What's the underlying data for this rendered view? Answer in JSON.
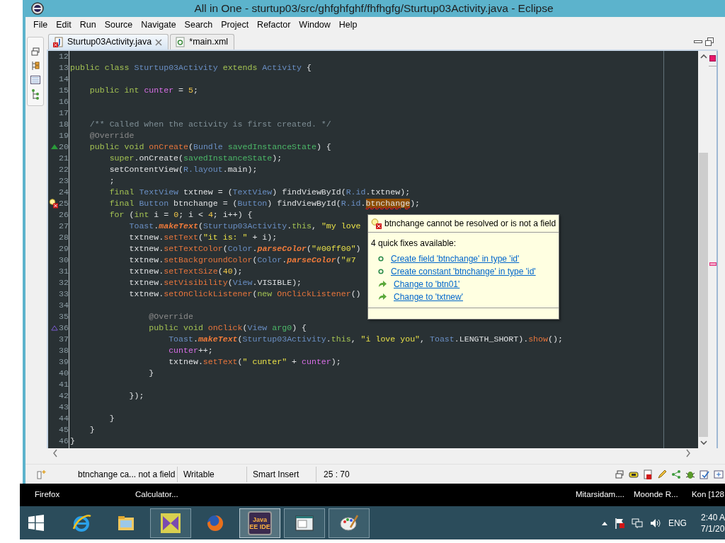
{
  "window": {
    "title": "All in One - sturtup03/src/ghfghfghf/fhfhgfg/Sturtup03Activity.java - Eclipse"
  },
  "menu": [
    "File",
    "Edit",
    "Run",
    "Source",
    "Navigate",
    "Search",
    "Project",
    "Refactor",
    "Window",
    "Help"
  ],
  "editor_tabs": [
    {
      "label": "Sturtup03Activity.java",
      "kind": "java",
      "error": true,
      "selected": true
    },
    {
      "label": "*main.xml",
      "kind": "xml",
      "error": false,
      "selected": false
    }
  ],
  "code_lines": [
    {
      "number": "12"
    },
    {
      "number": "13",
      "tokens": [
        {
          "kind": "kw",
          "text": "public class "
        },
        {
          "kind": "type",
          "text": "Sturtup03Activity "
        },
        {
          "kind": "kw",
          "text": "extends "
        },
        {
          "kind": "type",
          "text": "Activity "
        },
        {
          "kind": "plain",
          "text": "{"
        }
      ]
    },
    {
      "number": "14"
    },
    {
      "number": "15",
      "tokens": [
        {
          "kind": "kw",
          "text": "    public int "
        },
        {
          "kind": "field",
          "text": "cunter"
        },
        {
          "kind": "plain",
          "text": " = "
        },
        {
          "kind": "num",
          "text": "5"
        },
        {
          "kind": "plain",
          "text": ";"
        }
      ]
    },
    {
      "number": "16"
    },
    {
      "number": "17"
    },
    {
      "number": "18",
      "tokens": [
        {
          "kind": "comment",
          "text": "    /** Called when the activity is first created. */"
        }
      ]
    },
    {
      "number": "19",
      "tokens": [
        {
          "kind": "annot",
          "text": "    @Override"
        }
      ]
    },
    {
      "number": "20",
      "kind": "override",
      "tokens": [
        {
          "kind": "kw",
          "text": "    public void "
        },
        {
          "kind": "decl",
          "text": "onCreate"
        },
        {
          "kind": "plain",
          "text": "("
        },
        {
          "kind": "type",
          "text": "Bundle "
        },
        {
          "kind": "param",
          "text": "savedInstanceState"
        },
        {
          "kind": "plain",
          "text": ") {"
        }
      ]
    },
    {
      "number": "21",
      "tokens": [
        {
          "kind": "kw",
          "text": "        super"
        },
        {
          "kind": "plain",
          "text": ".onCreate("
        },
        {
          "kind": "param",
          "text": "savedInstanceState"
        },
        {
          "kind": "plain",
          "text": ");"
        }
      ]
    },
    {
      "number": "22",
      "tokens": [
        {
          "kind": "plain",
          "text": "        setContentView("
        },
        {
          "kind": "type",
          "text": "R.layout"
        },
        {
          "kind": "plain",
          "text": ".main);"
        }
      ]
    },
    {
      "number": "23",
      "tokens": [
        {
          "kind": "plain",
          "text": "        ;"
        }
      ]
    },
    {
      "number": "24",
      "tokens": [
        {
          "kind": "kw",
          "text": "        final "
        },
        {
          "kind": "type",
          "text": "TextView "
        },
        {
          "kind": "plain",
          "text": "txtnew = ("
        },
        {
          "kind": "type",
          "text": "TextView"
        },
        {
          "kind": "plain",
          "text": ") findViewById("
        },
        {
          "kind": "type",
          "text": "R.id"
        },
        {
          "kind": "plain",
          "text": ".txtnew);"
        }
      ]
    },
    {
      "number": "25",
      "kind": "error",
      "tokens": [
        {
          "kind": "kw",
          "text": "        final "
        },
        {
          "kind": "type",
          "text": "Button "
        },
        {
          "kind": "plain",
          "text": "btnchange = ("
        },
        {
          "kind": "type",
          "text": "Button"
        },
        {
          "kind": "plain",
          "text": ") findViewById("
        },
        {
          "kind": "type",
          "text": "R.id"
        },
        {
          "kind": "plain",
          "text": "."
        },
        {
          "kind": "error",
          "text": "btnchange"
        },
        {
          "kind": "plain",
          "text": ");"
        }
      ]
    },
    {
      "number": "26",
      "tokens": [
        {
          "kind": "kw",
          "text": "        for "
        },
        {
          "kind": "plain",
          "text": "("
        },
        {
          "kind": "kw",
          "text": "int "
        },
        {
          "kind": "plain",
          "text": "i = "
        },
        {
          "kind": "num",
          "text": "0"
        },
        {
          "kind": "plain",
          "text": "; i < "
        },
        {
          "kind": "num",
          "text": "4"
        },
        {
          "kind": "plain",
          "text": "; i++) {"
        }
      ]
    },
    {
      "number": "27",
      "tokens": [
        {
          "kind": "type",
          "text": "            Toast"
        },
        {
          "kind": "plain",
          "text": "."
        },
        {
          "kind": "static",
          "text": "makeText"
        },
        {
          "kind": "plain",
          "text": "("
        },
        {
          "kind": "type",
          "text": "Sturtup03Activity"
        },
        {
          "kind": "plain",
          "text": "."
        },
        {
          "kind": "kw",
          "text": "this"
        },
        {
          "kind": "plain",
          "text": ", "
        },
        {
          "kind": "str",
          "text": "\"my love"
        }
      ]
    },
    {
      "number": "28",
      "tokens": [
        {
          "kind": "plain",
          "text": "            txtnew."
        },
        {
          "kind": "call",
          "text": "setText"
        },
        {
          "kind": "plain",
          "text": "("
        },
        {
          "kind": "str",
          "text": "\"it is: \""
        },
        {
          "kind": "plain",
          "text": " + i);"
        }
      ]
    },
    {
      "number": "29",
      "tokens": [
        {
          "kind": "plain",
          "text": "            txtnew."
        },
        {
          "kind": "call",
          "text": "setTextColor"
        },
        {
          "kind": "plain",
          "text": "("
        },
        {
          "kind": "type",
          "text": "Color"
        },
        {
          "kind": "plain",
          "text": "."
        },
        {
          "kind": "static",
          "text": "parseColor"
        },
        {
          "kind": "plain",
          "text": "("
        },
        {
          "kind": "str",
          "text": "\"#00ff00\""
        },
        {
          "kind": "plain",
          "text": ")"
        }
      ]
    },
    {
      "number": "30",
      "tokens": [
        {
          "kind": "plain",
          "text": "            txtnew."
        },
        {
          "kind": "call",
          "text": "setBackgroundColor"
        },
        {
          "kind": "plain",
          "text": "("
        },
        {
          "kind": "type",
          "text": "Color"
        },
        {
          "kind": "plain",
          "text": "."
        },
        {
          "kind": "static",
          "text": "parseColor"
        },
        {
          "kind": "plain",
          "text": "("
        },
        {
          "kind": "str",
          "text": "\"#7"
        }
      ]
    },
    {
      "number": "31",
      "tokens": [
        {
          "kind": "plain",
          "text": "            txtnew."
        },
        {
          "kind": "call",
          "text": "setTextSize"
        },
        {
          "kind": "plain",
          "text": "("
        },
        {
          "kind": "num",
          "text": "40"
        },
        {
          "kind": "plain",
          "text": ");"
        }
      ]
    },
    {
      "number": "32",
      "tokens": [
        {
          "kind": "plain",
          "text": "            txtnew."
        },
        {
          "kind": "call",
          "text": "setVisibility"
        },
        {
          "kind": "plain",
          "text": "("
        },
        {
          "kind": "type",
          "text": "View"
        },
        {
          "kind": "plain",
          "text": ".VISIBLE);"
        }
      ]
    },
    {
      "number": "33",
      "tokens": [
        {
          "kind": "plain",
          "text": "            txtnew."
        },
        {
          "kind": "call",
          "text": "setOnClickListener"
        },
        {
          "kind": "plain",
          "text": "("
        },
        {
          "kind": "kw",
          "text": "new "
        },
        {
          "kind": "call",
          "text": "OnClickListener"
        },
        {
          "kind": "plain",
          "text": "()"
        }
      ]
    },
    {
      "number": "34"
    },
    {
      "number": "35",
      "tokens": [
        {
          "kind": "annot",
          "text": "                @Override"
        }
      ]
    },
    {
      "number": "36",
      "kind": "implements",
      "tokens": [
        {
          "kind": "kw",
          "text": "                public void "
        },
        {
          "kind": "decl",
          "text": "onClick"
        },
        {
          "kind": "plain",
          "text": "("
        },
        {
          "kind": "type",
          "text": "View "
        },
        {
          "kind": "param",
          "text": "arg0"
        },
        {
          "kind": "plain",
          "text": ") {"
        }
      ]
    },
    {
      "number": "37",
      "tokens": [
        {
          "kind": "type",
          "text": "                    Toast"
        },
        {
          "kind": "plain",
          "text": "."
        },
        {
          "kind": "static",
          "text": "makeText"
        },
        {
          "kind": "plain",
          "text": "("
        },
        {
          "kind": "type",
          "text": "Sturtup03Activity"
        },
        {
          "kind": "plain",
          "text": "."
        },
        {
          "kind": "kw",
          "text": "this"
        },
        {
          "kind": "plain",
          "text": ", "
        },
        {
          "kind": "str",
          "text": "\"i love you\""
        },
        {
          "kind": "plain",
          "text": ", "
        },
        {
          "kind": "type",
          "text": "Toast"
        },
        {
          "kind": "plain",
          "text": ".LENGTH_SHORT)."
        },
        {
          "kind": "call",
          "text": "show"
        },
        {
          "kind": "plain",
          "text": "();"
        }
      ]
    },
    {
      "number": "38",
      "tokens": [
        {
          "kind": "field",
          "text": "                    cunter"
        },
        {
          "kind": "plain",
          "text": "++;"
        }
      ]
    },
    {
      "number": "39",
      "tokens": [
        {
          "kind": "plain",
          "text": "                    txtnew."
        },
        {
          "kind": "call",
          "text": "setText"
        },
        {
          "kind": "plain",
          "text": "("
        },
        {
          "kind": "str",
          "text": "\" cunter\""
        },
        {
          "kind": "plain",
          "text": " + "
        },
        {
          "kind": "field",
          "text": "cunter"
        },
        {
          "kind": "plain",
          "text": ");"
        }
      ]
    },
    {
      "number": "40",
      "tokens": [
        {
          "kind": "plain",
          "text": "                }"
        }
      ]
    },
    {
      "number": "41"
    },
    {
      "number": "42",
      "tokens": [
        {
          "kind": "plain",
          "text": "            });"
        }
      ]
    },
    {
      "number": "43"
    },
    {
      "number": "44",
      "tokens": [
        {
          "kind": "plain",
          "text": "        }"
        }
      ]
    },
    {
      "number": "45",
      "tokens": [
        {
          "kind": "plain",
          "text": "    }"
        }
      ]
    },
    {
      "number": "46",
      "tokens": [
        {
          "kind": "plain",
          "text": "}"
        }
      ]
    }
  ],
  "quick_fix": {
    "message": "btnchange cannot be resolved or is not a field",
    "summary": "4 quick fixes available:",
    "fixes": [
      {
        "kind": "create",
        "label": "Create field 'btnchange' in type 'id'"
      },
      {
        "kind": "create",
        "label": "Create constant 'btnchange' in type 'id'"
      },
      {
        "kind": "change",
        "label": "Change to 'btn01'"
      },
      {
        "kind": "change",
        "label": "Change to 'txtnew'"
      }
    ]
  },
  "status_bar": {
    "message": "btnchange ca... not a field",
    "mode": "Writable",
    "insert_mode": "Smart Insert",
    "position": "25 : 70"
  },
  "taskbar_titles_left": [
    "Firefox",
    "Calculator..."
  ],
  "taskbar_titles_right": [
    "Mitarsidam....",
    "Moonde R...",
    "Kon [128"
  ],
  "taskbar_apps": [
    {
      "kind": "start",
      "running": false,
      "selected": false
    },
    {
      "kind": "browser",
      "running": false,
      "selected": false
    },
    {
      "kind": "folder",
      "running": false,
      "selected": false
    },
    {
      "kind": "studio",
      "running": true,
      "selected": false
    },
    {
      "kind": "firefox",
      "running": false,
      "selected": false
    },
    {
      "kind": "ide",
      "label": "Java EE IDE",
      "running": true,
      "selected": true
    },
    {
      "kind": "window",
      "running": true,
      "selected": false
    },
    {
      "kind": "paint",
      "running": true,
      "selected": false
    }
  ],
  "tray": {
    "language": "ENG",
    "time": "2:40 A",
    "date": "7/1/20"
  }
}
